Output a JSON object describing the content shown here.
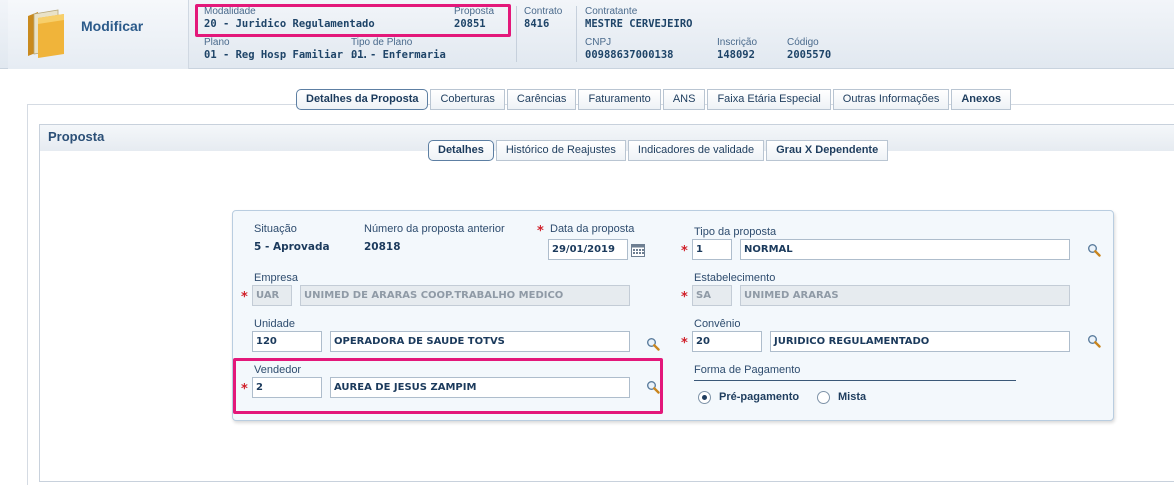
{
  "header": {
    "title": "Modificar",
    "modalidade_label": "Modalidade",
    "modalidade_value": "20 - Juridico Regulamentado",
    "proposta_label": "Proposta",
    "proposta_value": "20851",
    "contrato_label": "Contrato",
    "contrato_value": "8416",
    "contratante_label": "Contratante",
    "contratante_value": "MESTRE CERVEJEIRO",
    "plano_label": "Plano",
    "plano_value": "01 - Reg Hosp Familiar ...",
    "tipo_plano_label": "Tipo de Plano",
    "tipo_plano_value": "01 - Enfermaria",
    "cnpj_label": "CNPJ",
    "cnpj_value": "00988637000138",
    "inscricao_label": "Inscrição",
    "inscricao_value": "148092",
    "codigo_label": "Código",
    "codigo_value": "2005570",
    "folder_icon": "folder-icon"
  },
  "main_tabs": [
    {
      "label": "Detalhes da Proposta",
      "active": true
    },
    {
      "label": "Coberturas"
    },
    {
      "label": "Carências"
    },
    {
      "label": "Faturamento"
    },
    {
      "label": "ANS"
    },
    {
      "label": "Faixa Etária Especial"
    },
    {
      "label": "Outras Informações"
    },
    {
      "label": "Anexos",
      "bold": true
    }
  ],
  "panel": {
    "title": "Proposta"
  },
  "sub_tabs": [
    {
      "label": "Detalhes",
      "active": true
    },
    {
      "label": "Histórico de Reajustes"
    },
    {
      "label": "Indicadores de validade"
    },
    {
      "label": "Grau X Dependente",
      "bold": true
    }
  ],
  "form": {
    "situacao_label": "Situação",
    "situacao_value": "5 - Aprovada",
    "num_prop_ant_label": "Número da proposta anterior",
    "num_prop_ant_value": "20818",
    "data_proposta_label": "Data da proposta",
    "data_proposta_value": "29/01/2019",
    "tipo_proposta_label": "Tipo da proposta",
    "tipo_proposta_code": "1",
    "tipo_proposta_desc": "NORMAL",
    "empresa_label": "Empresa",
    "empresa_code": "UAR",
    "empresa_desc": "UNIMED DE ARARAS COOP.TRABALHO MEDICO",
    "estabelecimento_label": "Estabelecimento",
    "estabelecimento_code": "SA",
    "estabelecimento_desc": "UNIMED ARARAS",
    "unidade_label": "Unidade",
    "unidade_code": "120",
    "unidade_desc": "OPERADORA DE SAUDE TOTVS",
    "convenio_label": "Convênio",
    "convenio_code": "20",
    "convenio_desc": "JURIDICO REGULAMENTADO",
    "vendedor_label": "Vendedor",
    "vendedor_code": "2",
    "vendedor_desc": "AUREA DE JESUS ZAMPIM",
    "forma_pagamento_label": "Forma de Pagamento",
    "pagamento_options": [
      "Pré-pagamento",
      "Mista"
    ],
    "pagamento_selected": "Pré-pagamento",
    "required_mark": "*"
  },
  "colors": {
    "highlight": "#e3187a",
    "required": "#d0202a",
    "text": "#1b3a5c"
  }
}
